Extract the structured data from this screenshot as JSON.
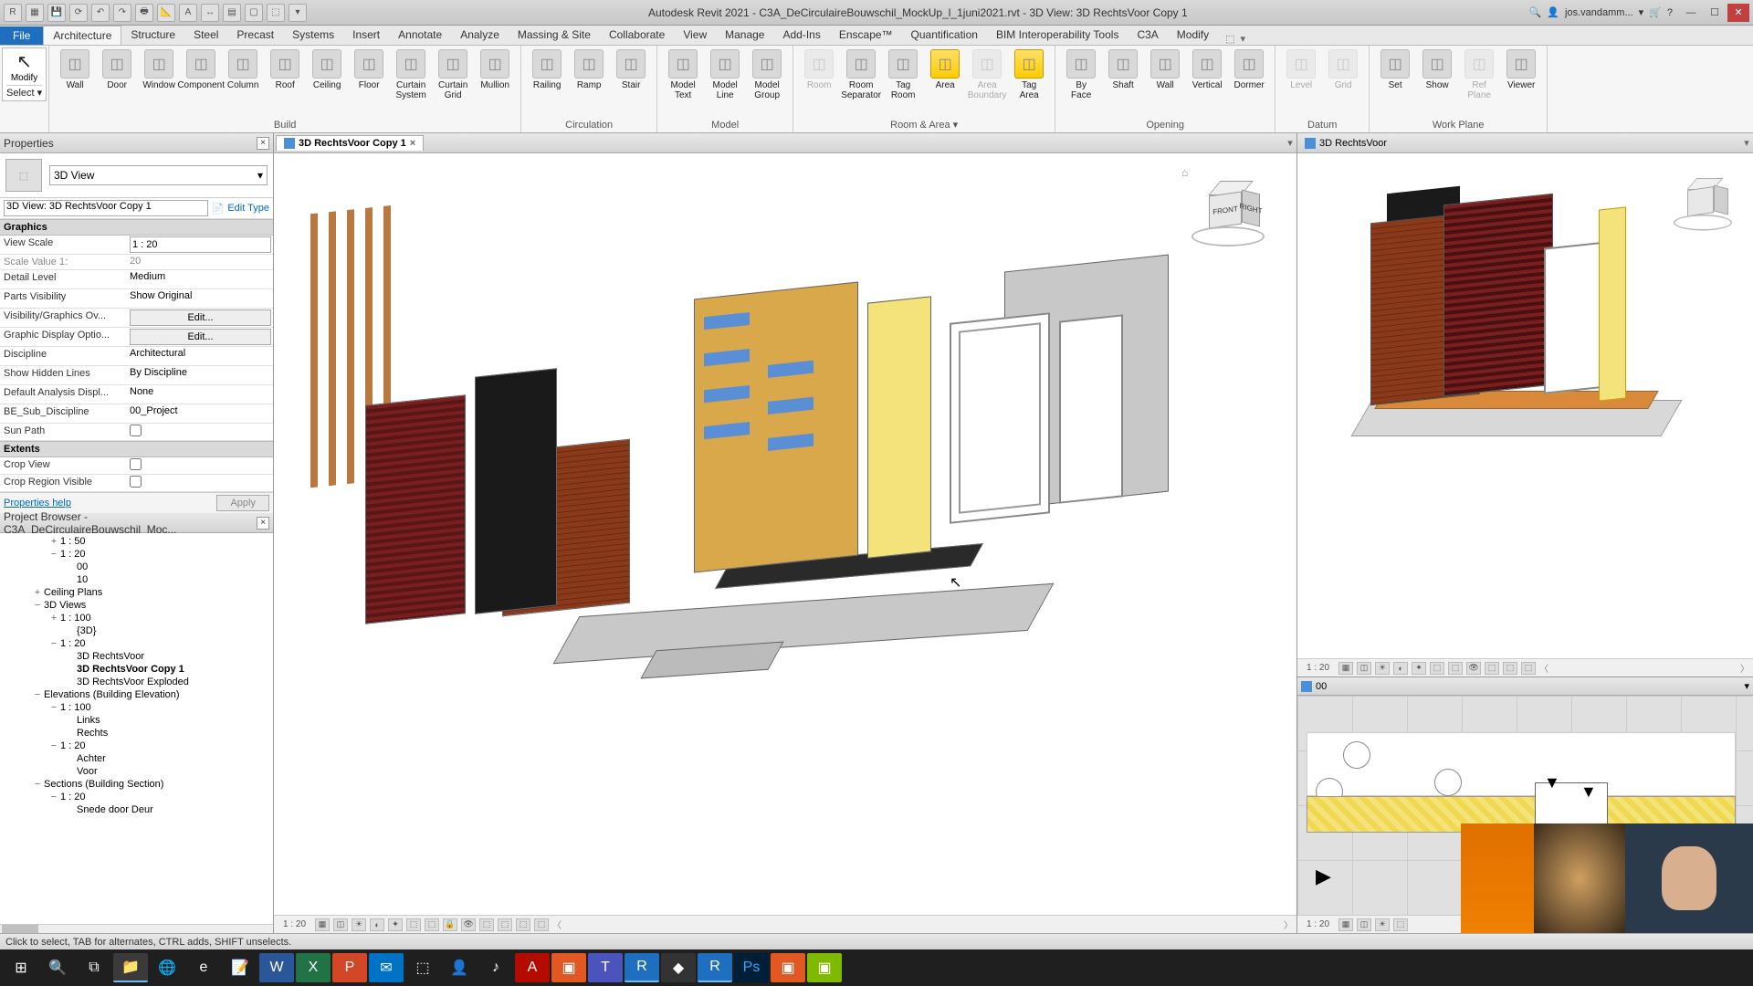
{
  "title": "Autodesk Revit 2021 - C3A_DeCirculaireBouwschil_MockUp_l_1juni2021.rvt - 3D View: 3D RechtsVoor Copy 1",
  "user": "jos.vandamm...",
  "qat": [
    "R",
    "▦",
    "⎘",
    "🖶",
    "↶",
    "↷",
    "⎌",
    "A",
    "✎",
    "▤",
    "⬚",
    "▢",
    "⬚",
    "⬚"
  ],
  "ribbon_tabs": {
    "file": "File",
    "items": [
      "Architecture",
      "Structure",
      "Steel",
      "Precast",
      "Systems",
      "Insert",
      "Annotate",
      "Analyze",
      "Massing & Site",
      "Collaborate",
      "View",
      "Manage",
      "Add-Ins",
      "Enscape™",
      "Quantification",
      "BIM Interoperability Tools",
      "C3A",
      "Modify"
    ],
    "active": "Architecture"
  },
  "ribbon": {
    "modify": {
      "label": "Modify",
      "select": "Select ▾"
    },
    "groups": [
      {
        "label": "Build",
        "tools": [
          {
            "t": "Wall"
          },
          {
            "t": "Door"
          },
          {
            "t": "Window"
          },
          {
            "t": "Component"
          },
          {
            "t": "Column"
          },
          {
            "t": "Roof"
          },
          {
            "t": "Ceiling"
          },
          {
            "t": "Floor"
          },
          {
            "t": "Curtain\nSystem"
          },
          {
            "t": "Curtain\nGrid"
          },
          {
            "t": "Mullion"
          }
        ]
      },
      {
        "label": "Circulation",
        "tools": [
          {
            "t": "Railing"
          },
          {
            "t": "Ramp"
          },
          {
            "t": "Stair"
          }
        ]
      },
      {
        "label": "Model",
        "tools": [
          {
            "t": "Model\nText"
          },
          {
            "t": "Model\nLine"
          },
          {
            "t": "Model\nGroup"
          }
        ]
      },
      {
        "label": "Room & Area ▾",
        "tools": [
          {
            "t": "Room",
            "disabled": true
          },
          {
            "t": "Room\nSeparator"
          },
          {
            "t": "Tag\nRoom"
          },
          {
            "t": "Area",
            "gold": true
          },
          {
            "t": "Area\nBoundary",
            "disabled": true
          },
          {
            "t": "Tag\nArea",
            "gold": true
          }
        ]
      },
      {
        "label": "Opening",
        "tools": [
          {
            "t": "By\nFace"
          },
          {
            "t": "Shaft"
          },
          {
            "t": "Wall"
          },
          {
            "t": "Vertical"
          },
          {
            "t": "Dormer"
          }
        ]
      },
      {
        "label": "Datum",
        "tools": [
          {
            "t": "Level",
            "disabled": true
          },
          {
            "t": "Grid",
            "disabled": true
          }
        ]
      },
      {
        "label": "Work Plane",
        "tools": [
          {
            "t": "Set"
          },
          {
            "t": "Show"
          },
          {
            "t": "Ref\nPlane",
            "disabled": true
          },
          {
            "t": "Viewer"
          }
        ]
      }
    ]
  },
  "properties": {
    "title": "Properties",
    "type_selector": "3D View",
    "instance": "3D View: 3D RechtsVoor Copy 1",
    "edit_type": "Edit Type",
    "sections": [
      {
        "name": "Graphics",
        "rows": [
          {
            "k": "View Scale",
            "v": "1 : 20",
            "kind": "input"
          },
          {
            "k": "Scale Value    1:",
            "v": "20",
            "kind": "readonly"
          },
          {
            "k": "Detail Level",
            "v": "Medium",
            "kind": "dd"
          },
          {
            "k": "Parts Visibility",
            "v": "Show Original",
            "kind": "dd"
          },
          {
            "k": "Visibility/Graphics Ov...",
            "v": "Edit...",
            "kind": "btn"
          },
          {
            "k": "Graphic Display Optio...",
            "v": "Edit...",
            "kind": "btn"
          },
          {
            "k": "Discipline",
            "v": "Architectural",
            "kind": "dd"
          },
          {
            "k": "Show Hidden Lines",
            "v": "By Discipline",
            "kind": "dd"
          },
          {
            "k": "Default Analysis Displ...",
            "v": "None",
            "kind": "dd"
          },
          {
            "k": "BE_Sub_Discipline",
            "v": "00_Project",
            "kind": "dd"
          },
          {
            "k": "Sun Path",
            "v": "",
            "kind": "check",
            "checked": false
          }
        ]
      },
      {
        "name": "Extents",
        "rows": [
          {
            "k": "Crop View",
            "v": "",
            "kind": "check",
            "checked": false
          },
          {
            "k": "Crop Region Visible",
            "v": "",
            "kind": "check",
            "checked": false
          }
        ]
      }
    ],
    "help": "Properties help",
    "apply": "Apply"
  },
  "browser": {
    "title": "Project Browser - C3A_DeCirculaireBouwschil_Moc...",
    "items": [
      {
        "d": 3,
        "tw": "+",
        "t": "1 : 50"
      },
      {
        "d": 3,
        "tw": "−",
        "t": "1 : 20"
      },
      {
        "d": 4,
        "t": "00"
      },
      {
        "d": 4,
        "t": "10"
      },
      {
        "d": 2,
        "tw": "+",
        "t": "Ceiling Plans"
      },
      {
        "d": 2,
        "tw": "−",
        "t": "3D Views"
      },
      {
        "d": 3,
        "tw": "+",
        "t": "1 : 100"
      },
      {
        "d": 4,
        "t": "{3D}"
      },
      {
        "d": 3,
        "tw": "−",
        "t": "1 : 20"
      },
      {
        "d": 4,
        "t": "3D RechtsVoor"
      },
      {
        "d": 4,
        "t": "3D RechtsVoor Copy 1",
        "bold": true
      },
      {
        "d": 4,
        "t": "3D RechtsVoor Exploded"
      },
      {
        "d": 2,
        "tw": "−",
        "t": "Elevations (Building Elevation)"
      },
      {
        "d": 3,
        "tw": "−",
        "t": "1 : 100"
      },
      {
        "d": 4,
        "t": "Links"
      },
      {
        "d": 4,
        "t": "Rechts"
      },
      {
        "d": 3,
        "tw": "−",
        "t": "1 : 20"
      },
      {
        "d": 4,
        "t": "Achter"
      },
      {
        "d": 4,
        "t": "Voor"
      },
      {
        "d": 2,
        "tw": "−",
        "t": "Sections (Building Section)"
      },
      {
        "d": 3,
        "tw": "−",
        "t": "1 : 20"
      },
      {
        "d": 4,
        "t": "Snede door Deur"
      }
    ]
  },
  "view_tab": {
    "name": "3D RechtsVoor Copy 1"
  },
  "viewcube": {
    "front": "FRONT",
    "right": "RIGHT"
  },
  "view_scale": "1 : 20",
  "right_view_title": "3D RechtsVoor",
  "right_plan_title": "00",
  "right_scale": "1 : 20",
  "status": "Click to select, TAB for alternates, CTRL adds, SHIFT unselects.",
  "taskbar_apps": [
    "⊞",
    "🔍",
    "⧉",
    "📁",
    "🌐",
    "e",
    "📝",
    "W",
    "X",
    "P",
    "✉",
    "⬚",
    "👤",
    "♪",
    "A",
    "▣",
    "T",
    "R",
    "◆",
    "R",
    "Ps",
    "▣",
    "▣"
  ]
}
